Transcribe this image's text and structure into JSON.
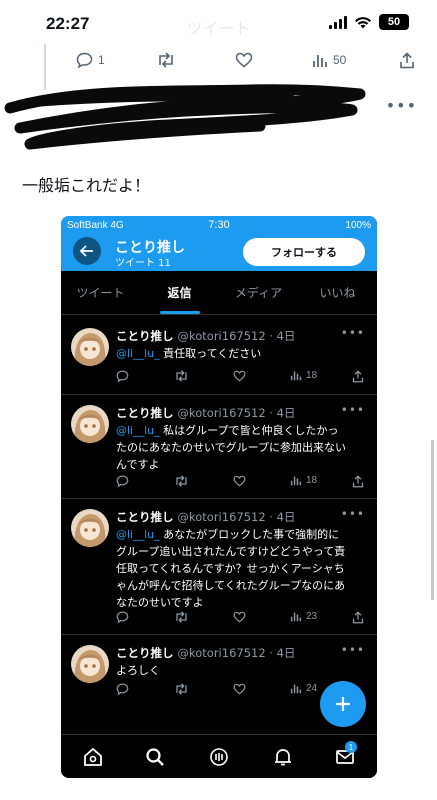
{
  "status_bar": {
    "time": "22:27",
    "ghost_title": "ツイート",
    "battery": "50"
  },
  "top_tweet_actions": {
    "reply_count": "1",
    "retweet_count": "",
    "like_count": "",
    "views_count": "50"
  },
  "tweet": {
    "text": "一般垢これだよ！"
  },
  "embedded_screenshot": {
    "status": {
      "carrier": "SoftBank  4G",
      "time": "7:30",
      "battery": "100%"
    },
    "header": {
      "name": "ことり推し",
      "subtitle": "ツイート 11",
      "follow_label": "フォローする"
    },
    "tabs": [
      {
        "label": "ツイート"
      },
      {
        "label": "返信"
      },
      {
        "label": "メディア"
      },
      {
        "label": "いいね"
      }
    ],
    "posts": [
      {
        "name": "ことり推し",
        "handle": "@kotori167512 · 4日",
        "mention": "@li__lu_",
        "text_lines": [
          " 責任取ってください"
        ],
        "views": "18"
      },
      {
        "name": "ことり推し",
        "handle": "@kotori167512 · 4日",
        "mention": "@li__lu_",
        "text_lines": [
          " 私はグループで皆と仲良くしたかっ",
          "たのにあなたのせいでグループに参加出来ない",
          "んですよ"
        ],
        "views": "18"
      },
      {
        "name": "ことり推し",
        "handle": "@kotori167512 · 4日",
        "mention": "@li__lu_",
        "text_lines": [
          " あなたがブロックした事で強制的に",
          "グループ追い出されたんですけどどうやって責",
          "任取ってくれるんですか？せっかくアーシャち",
          "ゃんが呼んで招待してくれたグループなのにあ",
          "なたのせいですよ"
        ],
        "views": "23"
      },
      {
        "name": "ことり推し",
        "handle": "@kotori167512 · 4日",
        "mention": "",
        "text_lines": [
          "よろしく"
        ],
        "views": "24"
      }
    ],
    "nav": {
      "dm_badge": "1"
    }
  },
  "colors": {
    "twitter_blue": "#1d9bf0",
    "dark_bg": "#000000",
    "muted": "#8b98a5"
  }
}
